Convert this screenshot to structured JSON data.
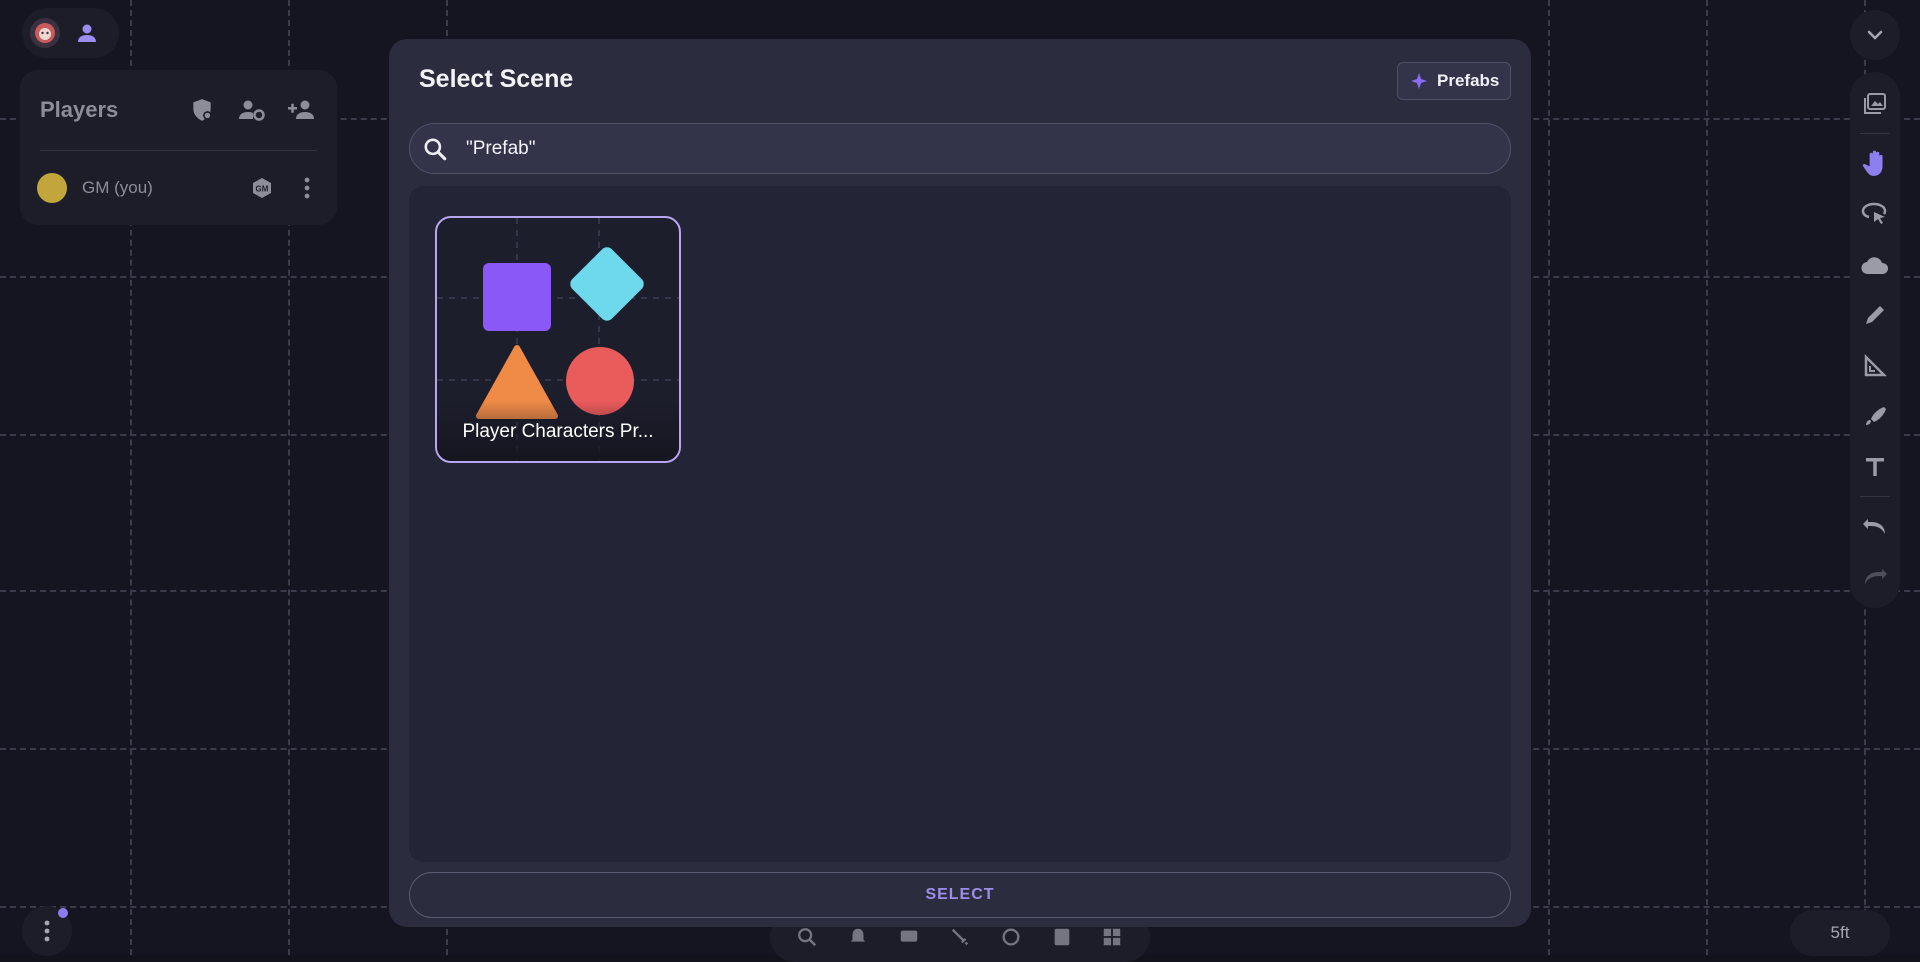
{
  "dialog": {
    "title": "Select Scene",
    "prefabs_label": "Prefabs",
    "search_value": "\"Prefab\"",
    "card_label": "Player Characters Pr...",
    "select_label": "SELECT"
  },
  "players": {
    "title": "Players",
    "list": [
      {
        "name": "GM (you)",
        "color": "#c2a53b",
        "badge": "GM"
      }
    ]
  },
  "scale": "5ft",
  "icons": {
    "top_left": [
      "avatar-icon",
      "person-icon"
    ],
    "players_header": [
      "shield-gm-icon",
      "player-settings-icon",
      "add-player-icon"
    ],
    "toolbar": [
      "image-icon",
      "hand-icon",
      "select-icon",
      "fog-icon",
      "draw-icon",
      "measure-icon",
      "brush-icon",
      "text-icon",
      "undo-icon",
      "redo-icon"
    ],
    "bottom_bar": [
      "search-icon",
      "bell-icon",
      "dice-icon",
      "sword-icon",
      "refresh-icon",
      "note-icon",
      "grid-icon"
    ]
  },
  "colors": {
    "accent": "#8b7cf0",
    "card_border": "#b8a6f2",
    "gm_dot": "#c2a53b",
    "shape_square": "#8a58f6",
    "shape_diamond": "#6ed8ec",
    "shape_triangle": "#ef8a47",
    "shape_circle": "#ea5b5b"
  }
}
